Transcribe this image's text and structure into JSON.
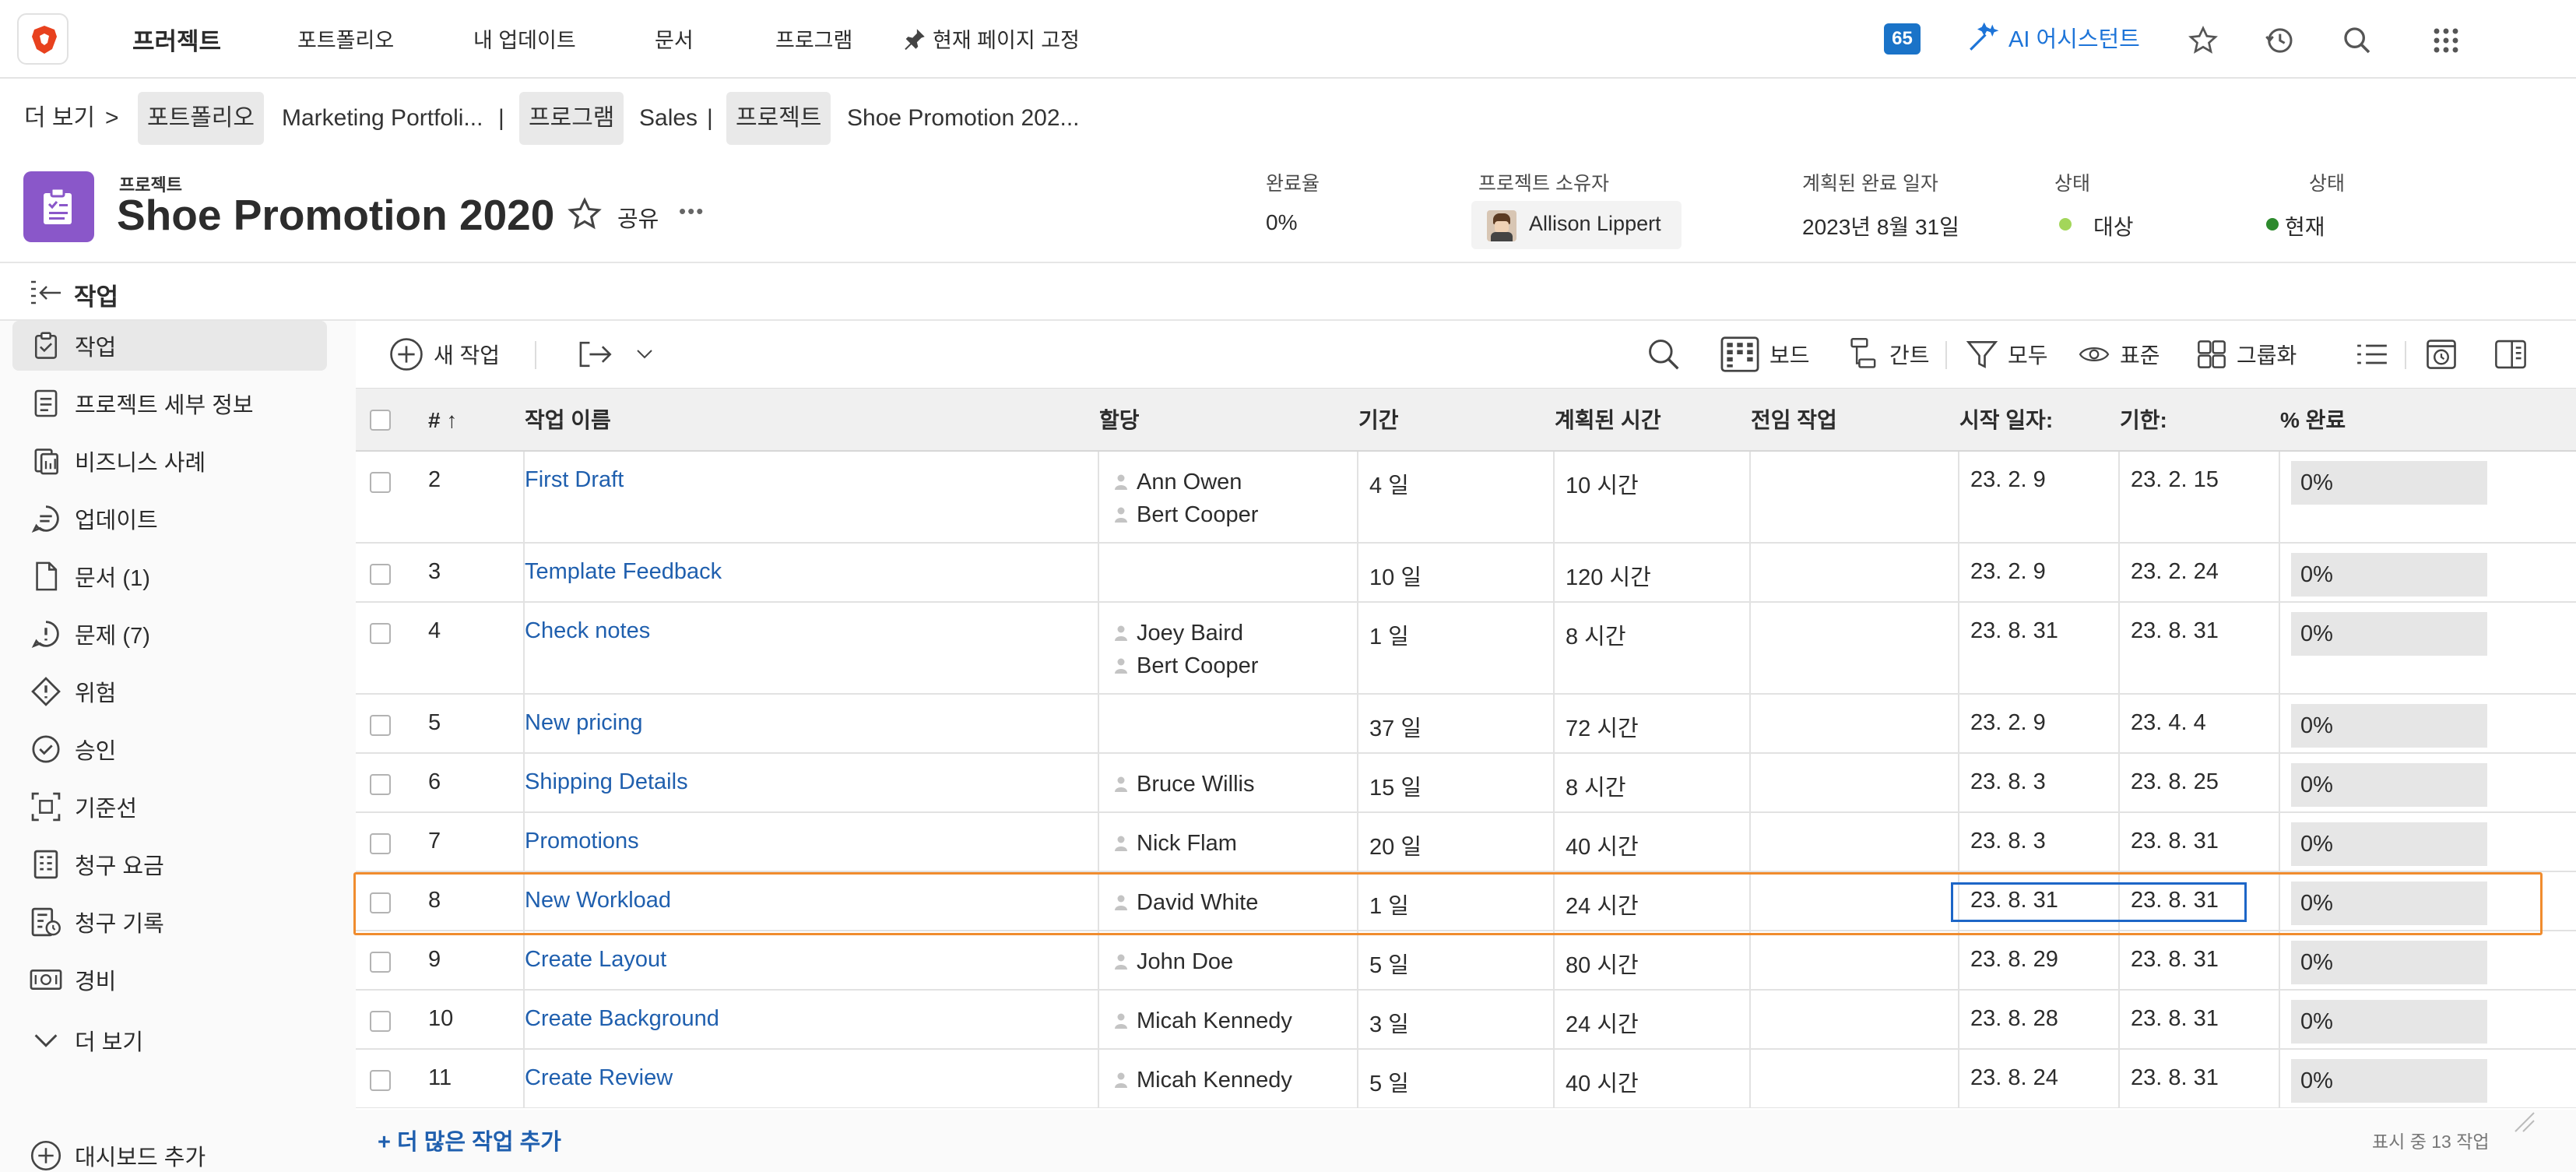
{
  "nav": {
    "brand": "프러젝트",
    "items": [
      "포트폴리오",
      "내 업데이트",
      "문서",
      "프로그램",
      "현재 페이지 고정"
    ],
    "badge": "65",
    "ai_assistant": "AI 어시스턴트"
  },
  "breadcrumb": {
    "more": "더 보기",
    "sep": ">",
    "portfolio_chip": "포트폴리오",
    "portfolio_name": "Marketing Portfoli...",
    "program_chip": "프로그램",
    "program_name": "Sales",
    "project_chip": "프로젝트",
    "project_name": "Shoe Promotion 202...",
    "divider": "|"
  },
  "project": {
    "eyebrow": "프로젝트",
    "title": "Shoe Promotion 2020",
    "share": "공유",
    "more": "•••",
    "fields": {
      "completion_label": "완료율",
      "completion_value": "0%",
      "owner_label": "프로젝트 소유자",
      "owner_value": "Allison Lippert",
      "planned_label": "계획된 완료 일자",
      "planned_value": "2023년 8월 31일",
      "status1_label": "상태",
      "status1_value": "대상",
      "status2_label": "상태",
      "status2_value": "현재"
    },
    "status_colors": {
      "target": "#a3d65a",
      "current": "#2d8a2d"
    }
  },
  "section": {
    "title": "작업"
  },
  "sidebar": {
    "items": [
      {
        "label": "작업",
        "icon": "tasks-icon"
      },
      {
        "label": "프로젝트 세부 정보",
        "icon": "details-icon"
      },
      {
        "label": "비즈니스 사례",
        "icon": "business-case-icon"
      },
      {
        "label": "업데이트",
        "icon": "updates-icon"
      },
      {
        "label": "문서 (1)",
        "icon": "document-icon"
      },
      {
        "label": "문제 (7)",
        "icon": "issues-icon"
      },
      {
        "label": "위험",
        "icon": "risk-icon"
      },
      {
        "label": "승인",
        "icon": "approval-icon"
      },
      {
        "label": "기준선",
        "icon": "baseline-icon"
      },
      {
        "label": "청구 요금",
        "icon": "billing-rates-icon"
      },
      {
        "label": "청구 기록",
        "icon": "billing-records-icon"
      },
      {
        "label": "경비",
        "icon": "expenses-icon"
      },
      {
        "label": "더 보기",
        "icon": "chevron-down-icon"
      }
    ],
    "add_dashboard": "대시보드 추가"
  },
  "toolbar": {
    "new_task": "새 작업",
    "board": "보드",
    "gantt": "간트",
    "filter": "모두",
    "view": "표준",
    "group": "그룹화"
  },
  "table": {
    "headers": [
      "#",
      "작업 이름",
      "할당",
      "기간",
      "계획된 시간",
      "전임 작업",
      "시작 일자:",
      "기한:",
      "% 완료"
    ],
    "rows": [
      {
        "num": "2",
        "name": "First Draft",
        "assignees": [
          "Ann Owen",
          "Bert Cooper"
        ],
        "duration": "4 일",
        "hours": "10 시간",
        "pred": "",
        "start": "23. 2. 9",
        "due": "23. 2. 15",
        "pct": "0%"
      },
      {
        "num": "3",
        "name": "Template Feedback",
        "assignees": [],
        "duration": "10 일",
        "hours": "120 시간",
        "pred": "",
        "start": "23. 2. 9",
        "due": "23. 2. 24",
        "pct": "0%"
      },
      {
        "num": "4",
        "name": "Check notes",
        "assignees": [
          "Joey Baird",
          "Bert Cooper"
        ],
        "duration": "1 일",
        "hours": "8 시간",
        "pred": "",
        "start": "23. 8. 31",
        "due": "23. 8. 31",
        "pct": "0%"
      },
      {
        "num": "5",
        "name": "New pricing",
        "assignees": [],
        "duration": "37 일",
        "hours": "72 시간",
        "pred": "",
        "start": "23. 2. 9",
        "due": "23. 4. 4",
        "pct": "0%"
      },
      {
        "num": "6",
        "name": "Shipping Details",
        "assignees": [
          "Bruce Willis"
        ],
        "duration": "15 일",
        "hours": "8 시간",
        "pred": "",
        "start": "23. 8. 3",
        "due": "23. 8. 25",
        "pct": "0%"
      },
      {
        "num": "7",
        "name": "Promotions",
        "assignees": [
          "Nick Flam"
        ],
        "duration": "20 일",
        "hours": "40 시간",
        "pred": "",
        "start": "23. 8. 3",
        "due": "23. 8. 31",
        "pct": "0%"
      },
      {
        "num": "8",
        "name": "New Workload",
        "assignees": [
          "David White"
        ],
        "duration": "1 일",
        "hours": "24 시간",
        "pred": "",
        "start": "23. 8. 31",
        "due": "23. 8. 31",
        "pct": "0%"
      },
      {
        "num": "9",
        "name": "Create Layout",
        "assignees": [
          "John Doe"
        ],
        "duration": "5 일",
        "hours": "80 시간",
        "pred": "",
        "start": "23. 8. 29",
        "due": "23. 8. 31",
        "pct": "0%"
      },
      {
        "num": "10",
        "name": "Create Background",
        "assignees": [
          "Micah Kennedy"
        ],
        "duration": "3 일",
        "hours": "24 시간",
        "pred": "",
        "start": "23. 8. 28",
        "due": "23. 8. 31",
        "pct": "0%"
      },
      {
        "num": "11",
        "name": "Create Review",
        "assignees": [
          "Micah Kennedy"
        ],
        "duration": "5 일",
        "hours": "40 시간",
        "pred": "",
        "start": "23. 8. 24",
        "due": "23. 8. 31",
        "pct": "0%"
      }
    ]
  },
  "footer": {
    "add_more": "+ 더 많은 작업 추가",
    "count": "표시 중 13 작업"
  },
  "colors": {
    "accent": "#1d74d8",
    "link": "#1f5fae",
    "highlight": "#f08c2e",
    "selection": "#1d66c7"
  }
}
